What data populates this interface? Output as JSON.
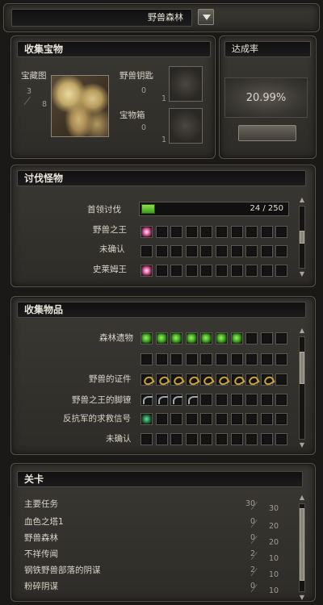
{
  "header": {
    "region_name": "野兽森林",
    "dropdown_icon": "triangle-down-icon"
  },
  "collect_treasure": {
    "title": "收集宝物",
    "treasure_map": {
      "label": "宝藏图",
      "current": "3",
      "total": "8"
    },
    "beast_key": {
      "label": "野兽钥匙",
      "top": "0",
      "bottom": "1"
    },
    "treasure_chest": {
      "label": "宝物箱",
      "top": "0",
      "bottom": "1"
    }
  },
  "completion": {
    "title": "达成率",
    "value": "20.99%"
  },
  "hunt_monsters": {
    "title": "讨伐怪物",
    "rows": [
      {
        "label": "首领讨伐",
        "progress_text": "24 / 250",
        "progress": 0.096
      },
      {
        "label": "野兽之王"
      },
      {
        "label": "未确认"
      },
      {
        "label": "史莱姆王"
      }
    ]
  },
  "collect_items": {
    "title": "收集物品",
    "rows": [
      {
        "label": "森林遗物"
      },
      {
        "label": ""
      },
      {
        "label": "野兽的证件"
      },
      {
        "label": "野兽之王的脚镣"
      },
      {
        "label": "反抗军的求救信号"
      },
      {
        "label": "未确认"
      }
    ]
  },
  "stages": {
    "title": "关卡",
    "rows": [
      {
        "name": "主要任务",
        "current": "30",
        "total": "30"
      },
      {
        "name": "血色之塔1",
        "current": "0",
        "total": "20"
      },
      {
        "name": "野兽森林",
        "current": "0",
        "total": "20"
      },
      {
        "name": "不祥传闻",
        "current": "2",
        "total": "10"
      },
      {
        "name": "钢铁野兽部落的阴谋",
        "current": "2",
        "total": "10"
      },
      {
        "name": "粉碎阴谋",
        "current": "0",
        "total": "10"
      }
    ]
  },
  "colors": {
    "progress_fill": "#5fc02c",
    "accent_green": "#3fa224",
    "frame": "#3a3833"
  }
}
